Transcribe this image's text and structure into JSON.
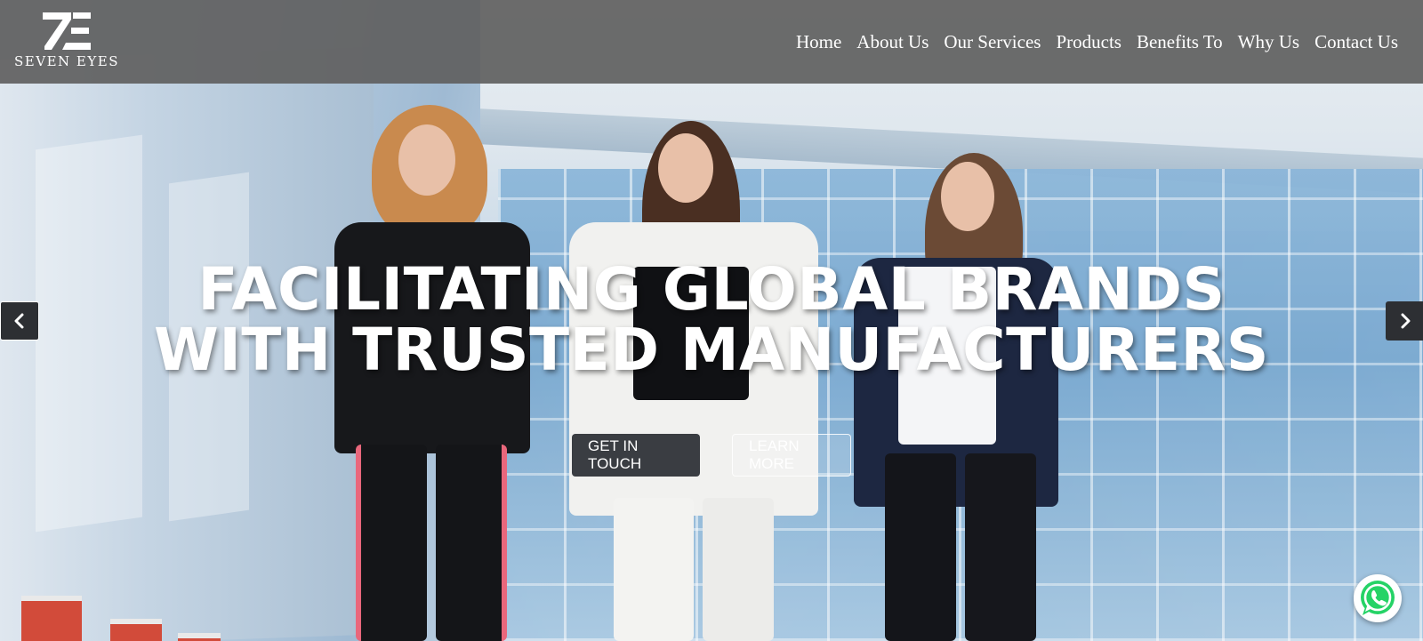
{
  "brand": {
    "name": "SEVEN EYES",
    "logo_icon": "ze-monogram-icon"
  },
  "nav": {
    "items": [
      {
        "label": "Home"
      },
      {
        "label": "About Us"
      },
      {
        "label": "Our Services"
      },
      {
        "label": "Products"
      },
      {
        "label": "Benefits To"
      },
      {
        "label": "Why Us"
      },
      {
        "label": "Contact Us"
      }
    ]
  },
  "hero": {
    "title_line1": "FACILITATING GLOBAL BRANDS",
    "title_line2": "WITH TRUSTED MANUFACTURERS",
    "primary_cta": "GET IN TOUCH",
    "secondary_cta": "LEARN MORE"
  },
  "carousel": {
    "prev_icon": "chevron-left-icon",
    "next_icon": "chevron-right-icon"
  },
  "floating": {
    "whatsapp_icon": "whatsapp-icon"
  },
  "colors": {
    "navbar_bg": "#606060",
    "primary_button": "#3a3d42",
    "arrow_bg": "#2d2f33",
    "whatsapp_green": "#25d366"
  }
}
